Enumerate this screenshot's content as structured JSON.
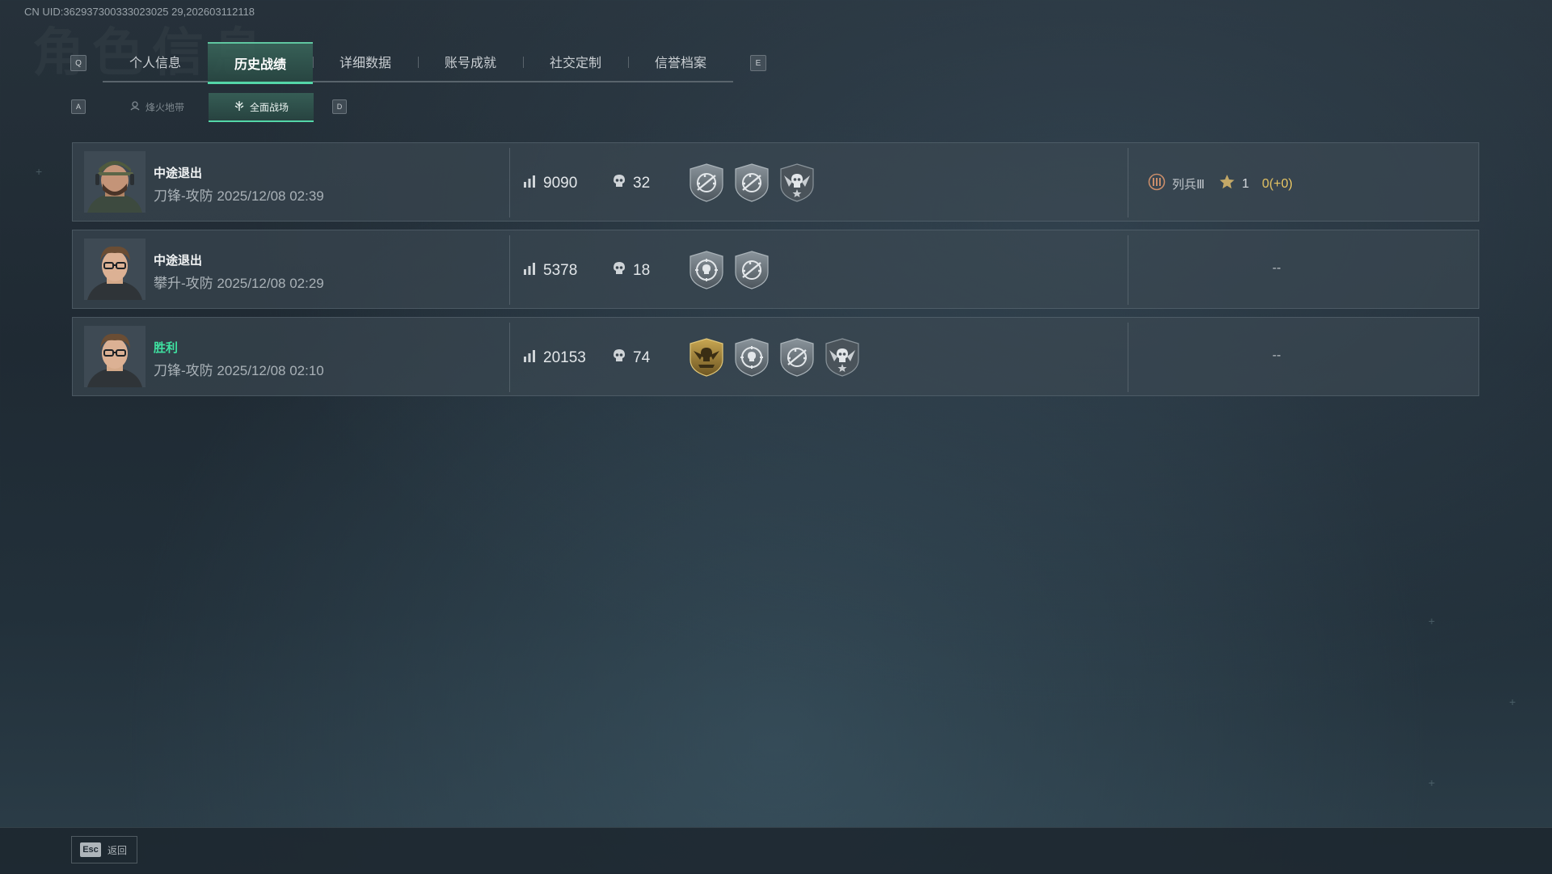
{
  "uid": "CN UID:362937300333023025 29,202603112118",
  "tabs": {
    "key_left": "Q",
    "key_right": "E",
    "items": [
      {
        "label": "个人信息"
      },
      {
        "label": "历史战绩"
      },
      {
        "label": "详细数据"
      },
      {
        "label": "账号成就"
      },
      {
        "label": "社交定制"
      },
      {
        "label": "信誉档案"
      }
    ],
    "active_index": 1
  },
  "subtabs": {
    "key_left": "A",
    "key_right": "D",
    "items": [
      {
        "label": "烽火地带",
        "icon": "extraction-icon"
      },
      {
        "label": "全面战场",
        "icon": "battlefield-icon"
      }
    ],
    "active_index": 1
  },
  "matches": [
    {
      "result": "中途退出",
      "mode": "刀锋-攻防",
      "time": "2025/12/08 02:39",
      "score": "9090",
      "kills": "32",
      "badges": [
        "rifle-crosshair-badge",
        "rifle-crosshair-badge",
        "skull-wings-badge"
      ],
      "rank_label": "列兵Ⅲ",
      "stars": "1",
      "exp": "0(+0)"
    },
    {
      "result": "中途退出",
      "mode": "攀升-攻防",
      "time": "2025/12/08 02:29",
      "score": "5378",
      "kills": "18",
      "badges": [
        "skull-target-badge",
        "rifle-crosshair-badge"
      ],
      "placeholder": "--"
    },
    {
      "result": "胜利",
      "mode": "刀锋-攻防",
      "time": "2025/12/08 02:10",
      "score": "20153",
      "kills": "74",
      "badges": [
        "gold-eagle-badge",
        "skull-target-badge",
        "rifle-crosshair-badge",
        "skull-wings-badge"
      ],
      "placeholder": "--"
    }
  ],
  "footer": {
    "esc_key": "Esc",
    "back_label": "返回"
  },
  "colors": {
    "accent": "#54d6a8",
    "win": "#3fe0a0",
    "exp": "#e6c463",
    "gold_badge": "#a8893a"
  }
}
